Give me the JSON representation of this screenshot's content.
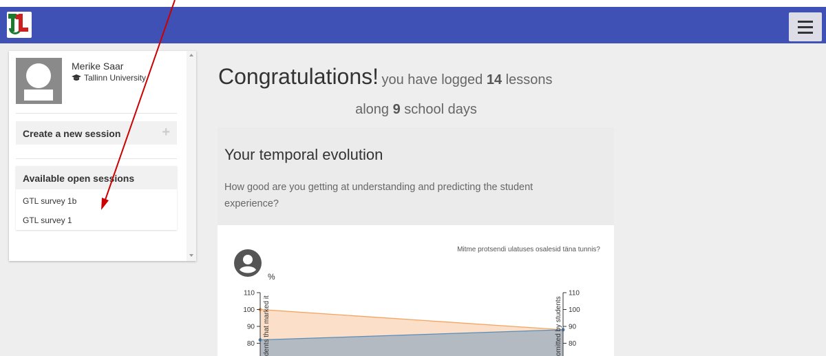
{
  "header": {
    "logo_alt": "GTL logo",
    "menu_icon": "hamburger-menu-icon"
  },
  "sidebar": {
    "user_name": "Merike Saar",
    "org_icon": "graduation-cap-icon",
    "org": "Tallinn University",
    "create_label": "Create a new session",
    "create_icon": "plus-icon",
    "open_sessions_label": "Available open sessions",
    "sessions": [
      "GTL survey 1b",
      "GTL survey 1"
    ]
  },
  "main": {
    "congrats": "Congratulations!",
    "logged_prefix": "you have logged",
    "lessons_count": "14",
    "lessons_label": "lessons",
    "days_prefix": "along",
    "days_count": "9",
    "days_label": "school days",
    "card_title": "Your temporal evolution",
    "card_desc": "How good are you getting at understanding and predicting the student experience?",
    "chart_question": "Mitme protsendi ulatuses osalesid täna tunnis?",
    "person_icon": "user-circle-icon",
    "percent_label": "%"
  },
  "chart_data": {
    "type": "area",
    "yticks_left": [
      "110",
      "100",
      "90",
      "80"
    ],
    "yticks_right": [
      "110",
      "100",
      "90",
      "80"
    ],
    "ylabel_left": "dents that marked it",
    "ylabel_right": "omitted by students",
    "series": [
      {
        "color": "#f4a460",
        "values": [
          100,
          88
        ]
      },
      {
        "color": "#5b8db8",
        "values": [
          82,
          88
        ]
      }
    ]
  },
  "annotation": {
    "color": "#cc0000"
  }
}
